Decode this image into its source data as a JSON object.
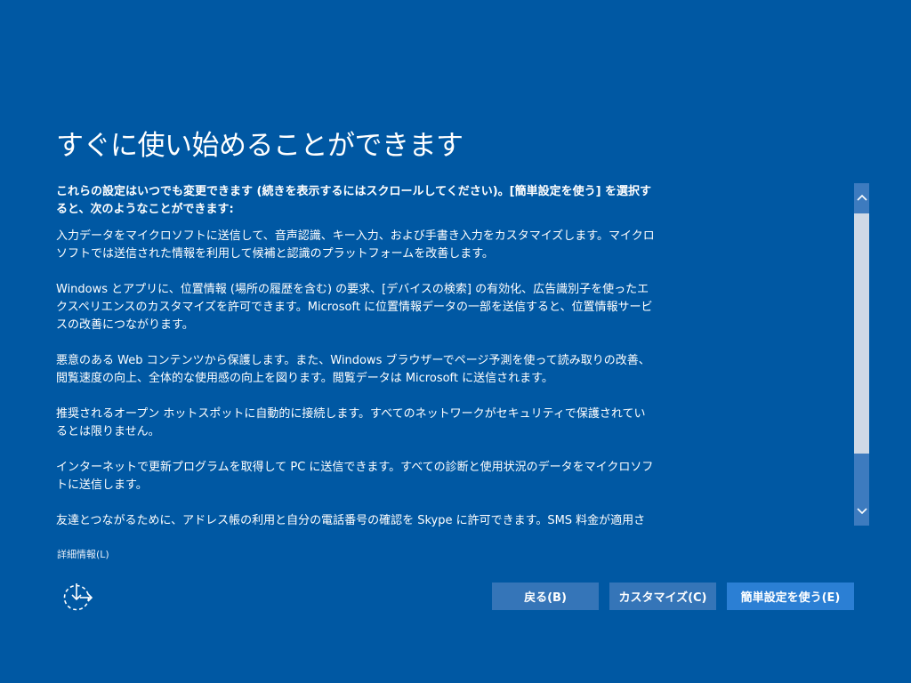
{
  "page": {
    "title": "すぐに使い始めることができます"
  },
  "content": {
    "intro": "これらの設定はいつでも変更できます (続きを表示するにはスクロールしてください)。[簡単設定を使う] を選択すると、次のようなことができます:",
    "paragraphs": [
      "入力データをマイクロソフトに送信して、音声認識、キー入力、および手書き入力をカスタマイズします。マイクロソフトでは送信された情報を利用して候補と認識のプラットフォームを改善します。",
      "Windows とアプリに、位置情報 (場所の履歴を含む) の要求、[デバイスの検索] の有効化、広告識別子を使ったエクスペリエンスのカスタマイズを許可できます。Microsoft に位置情報データの一部を送信すると、位置情報サービスの改善につながります。",
      "悪意のある Web コンテンツから保護します。また、Windows ブラウザーでページ予測を使って読み取りの改善、閲覧速度の向上、全体的な使用感の向上を図ります。閲覧データは Microsoft に送信されます。",
      "推奨されるオープン ホットスポットに自動的に接続します。すべてのネットワークがセキュリティで保護されているとは限りません。",
      "インターネットで更新プログラムを取得して PC に送信できます。すべての診断と使用状況のデータをマイクロソフトに送信します。",
      "友達とつながるために、アドレス帳の利用と自分の電話番号の確認を Skype に許可できます。SMS 料金が適用さ"
    ]
  },
  "links": {
    "more_info": "詳細情報(L)"
  },
  "buttons": {
    "back": "戻る(B)",
    "customize": "カスタマイズ(C)",
    "express": "簡単設定を使う(E)"
  },
  "icons": {
    "ease_of_access": "ease-of-access-icon",
    "scroll_up": "chevron-up-icon",
    "scroll_down": "chevron-down-icon"
  },
  "colors": {
    "background": "#0058a3",
    "primary_button": "#2b7fd4",
    "secondary_button": "#3575b8"
  }
}
